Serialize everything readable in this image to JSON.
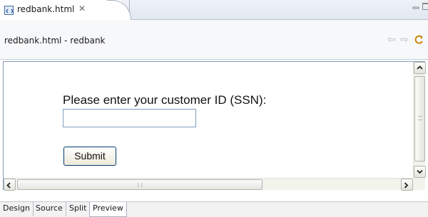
{
  "tab": {
    "label": "redbank.html",
    "close_glyph": "✕"
  },
  "window": {
    "minimize": "minimize-icon",
    "maximize": "maximize-icon"
  },
  "header": {
    "title": "redbank.html - redbank",
    "back_icon": "back-arrow-icon",
    "forward_icon": "forward-arrow-icon",
    "refresh_icon": "refresh-icon"
  },
  "preview": {
    "prompt": "Please enter your customer ID (SSN):",
    "id_field_value": "",
    "submit_label": "Submit"
  },
  "bottom_tabs": [
    {
      "label": "Design",
      "active": false
    },
    {
      "label": "Source",
      "active": false
    },
    {
      "label": "Split",
      "active": false
    },
    {
      "label": "Preview",
      "active": true
    }
  ],
  "colors": {
    "accent": "#7f9db9",
    "button_border": "#003c74"
  }
}
